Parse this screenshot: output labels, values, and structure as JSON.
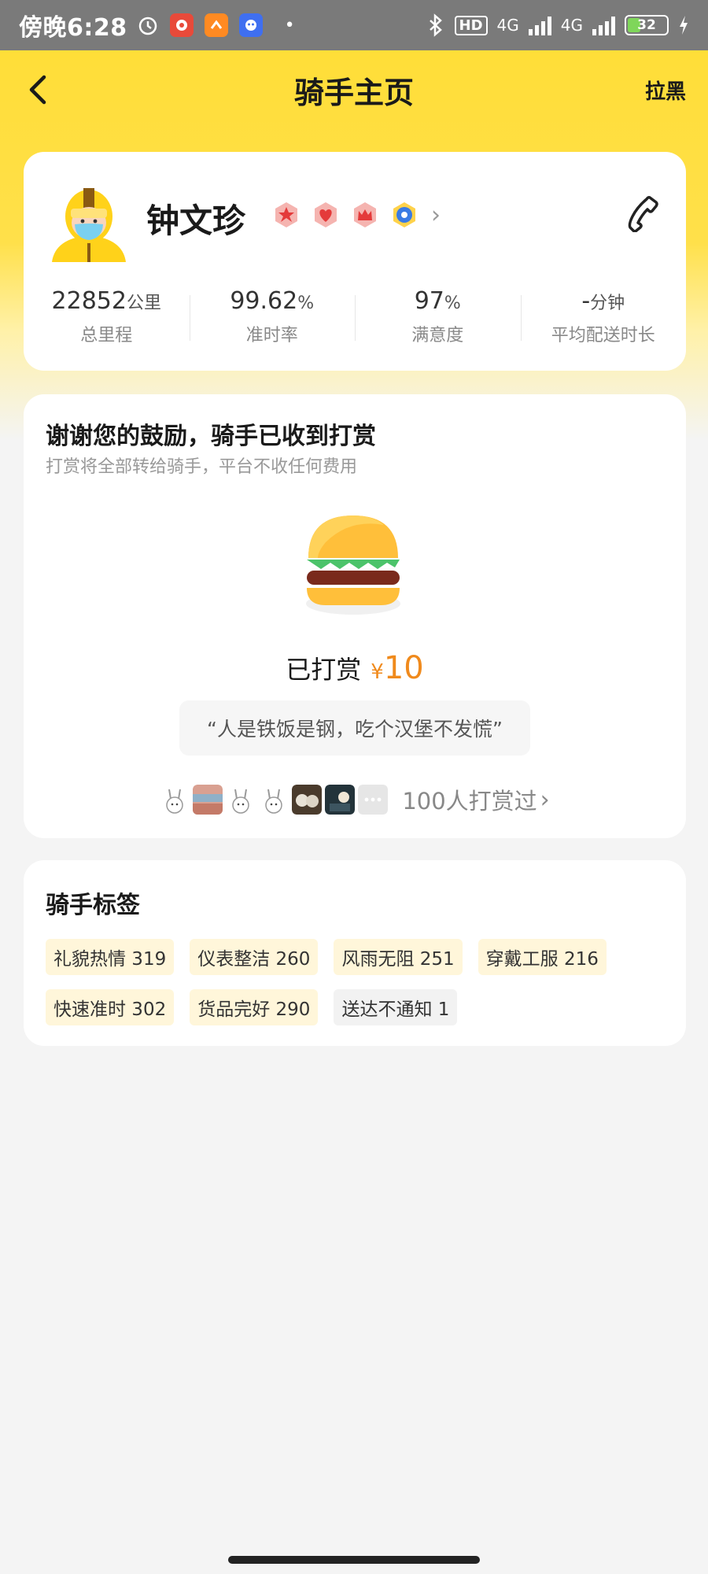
{
  "status_bar": {
    "time": "傍晚6:28",
    "network_1": "4G",
    "network_2": "4G",
    "battery": "32",
    "hd_label": "HD"
  },
  "nav": {
    "title": "骑手主页",
    "block_label": "拉黑"
  },
  "rider": {
    "name": "钟文珍",
    "stats": [
      {
        "value": "22852",
        "unit": "公里",
        "label": "总里程"
      },
      {
        "value": "99.62",
        "unit": "%",
        "label": "准时率"
      },
      {
        "value": "97",
        "unit": "%",
        "label": "满意度"
      },
      {
        "value": "-",
        "unit": "分钟",
        "label": "平均配送时长"
      }
    ]
  },
  "tip": {
    "title": "谢谢您的鼓励，骑手已收到打赏",
    "subtitle": "打赏将全部转给骑手，平台不收任何费用",
    "amount_label": "已打赏",
    "currency": "¥",
    "amount": "10",
    "quote": "“人是铁饭是钢，吃个汉堡不发慌”",
    "tippers_count": "100人打赏过"
  },
  "tags": {
    "title": "骑手标签",
    "items": [
      {
        "label": "礼貌热情 319"
      },
      {
        "label": "仪表整洁 260"
      },
      {
        "label": "风雨无阻 251"
      },
      {
        "label": "穿戴工服 216"
      },
      {
        "label": "快速准时 302"
      },
      {
        "label": "货品完好 290"
      },
      {
        "label": "送达不通知 1"
      }
    ]
  },
  "colors": {
    "brand_yellow": "#ffdd33",
    "tip_orange": "#f08a1c",
    "tag_bg": "#fff6da"
  }
}
